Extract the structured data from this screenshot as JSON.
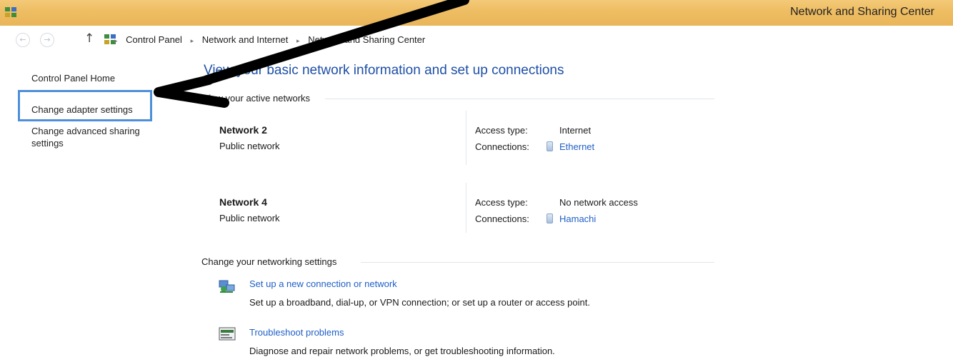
{
  "window": {
    "title": "Network and Sharing Center"
  },
  "address": {
    "back_glyph": "←",
    "forward_glyph": "→",
    "up_glyph": "↑",
    "crumbs": [
      "Control Panel",
      "Network and Internet",
      "Network and Sharing Center"
    ],
    "separator": "▸"
  },
  "sidebar": {
    "items": [
      {
        "label": "Control Panel Home"
      },
      {
        "label": "Change adapter settings"
      },
      {
        "label": "Change advanced sharing settings"
      }
    ]
  },
  "main": {
    "title": "View your basic network information and set up connections",
    "active_heading": "View your active networks",
    "networks": [
      {
        "name": "Network 2",
        "type": "Public network",
        "access_label": "Access type:",
        "access": "Internet",
        "conn_label": "Connections:",
        "connection": "Ethernet"
      },
      {
        "name": "Network 4",
        "type": "Public network",
        "access_label": "Access type:",
        "access": "No network access",
        "conn_label": "Connections:",
        "connection": "Hamachi"
      }
    ],
    "settings_heading": "Change your networking settings",
    "tasks": [
      {
        "link": "Set up a new connection or network",
        "desc": "Set up a broadband, dial-up, or VPN connection; or set up a router or access point.",
        "icon": "network-setup-icon"
      },
      {
        "link": "Troubleshoot problems",
        "desc": "Diagnose and repair network problems, or get troubleshooting information.",
        "icon": "troubleshoot-icon"
      }
    ]
  },
  "colors": {
    "title_bar": "#eebd62",
    "link": "#1f5fc6",
    "highlight": "#4d8fd9"
  }
}
